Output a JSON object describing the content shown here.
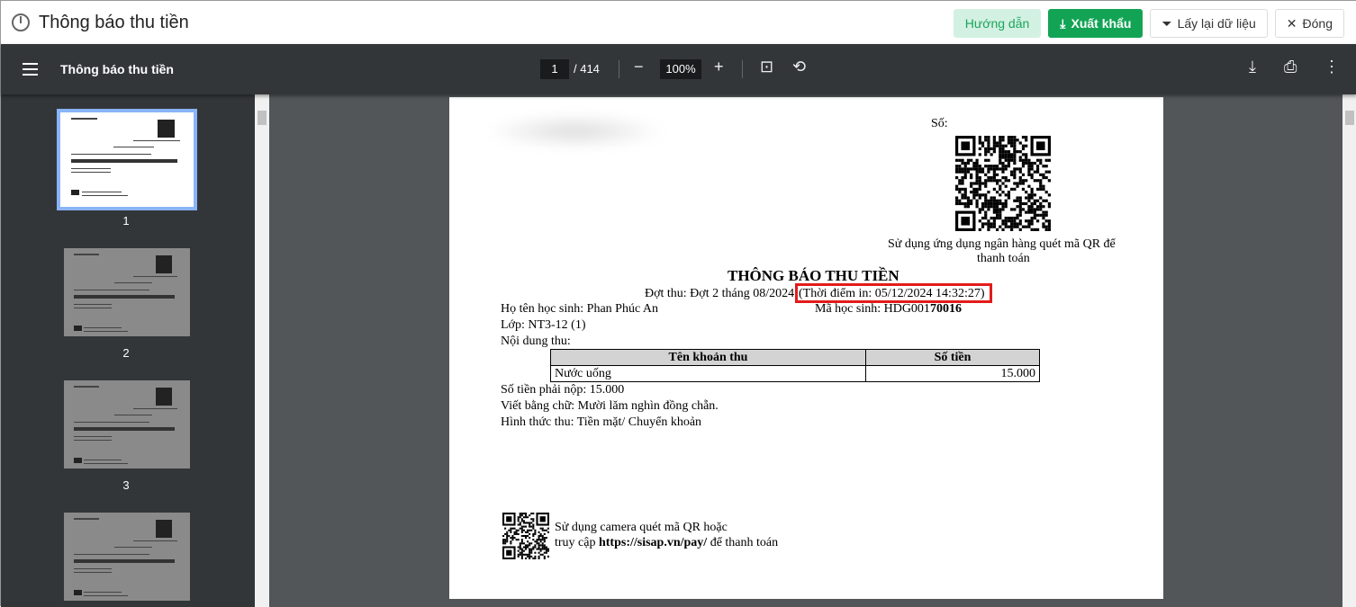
{
  "header": {
    "title": "Thông báo thu tiền",
    "buttons": {
      "help": "Hướng dẫn",
      "export": "Xuất khẩu",
      "reload": "Lấy lại dữ liệu",
      "close": "Đóng"
    }
  },
  "viewer": {
    "title": "Thông báo thu tiền",
    "current_page": "1",
    "total_pages": "/ 414",
    "zoom": "100%"
  },
  "thumbnails": [
    {
      "label": "1"
    },
    {
      "label": "2"
    },
    {
      "label": "3"
    }
  ],
  "document": {
    "so_label": "Số:",
    "qr_caption_1": "Sử dụng ứng dụng ngân hàng quét mã QR để",
    "qr_caption_2": "thanh toán",
    "heading": "THÔNG BÁO THU TIỀN",
    "period": "Đợt thu: Đợt 2 tháng 08/2024",
    "print_time": "(Thời điểm in: 05/12/2024 14:32:27)",
    "student_name": "Họ tên học sinh: Phan Phúc An",
    "student_code_prefix": "Mã học sinh: HDG001",
    "student_code_bold": "70016",
    "class": "Lớp: NT3-12 (1)",
    "content_label": "Nội dung thu:",
    "table": {
      "headers": [
        "Tên khoản thu",
        "Số tiền"
      ],
      "rows": [
        [
          "Nước uống",
          "15.000"
        ]
      ]
    },
    "amount_due": "Số tiền phải nộp: 15.000",
    "in_words": "Viết bằng chữ: Mười lăm nghìn đồng chẵn.",
    "payment_method": "Hình thức thu: Tiền mặt/ Chuyển khoản",
    "footer_1": "Sử dụng camera quét mã QR hoặc",
    "footer_2_prefix": "truy cập ",
    "footer_url": "https://sisap.vn/pay/",
    "footer_2_suffix": " để thanh toán"
  },
  "colors": {
    "export": "#12a454",
    "help_bg": "#d3f1e2",
    "highlight": "#e31b1b",
    "toolbar": "#323639",
    "viewer_bg": "#525659"
  }
}
